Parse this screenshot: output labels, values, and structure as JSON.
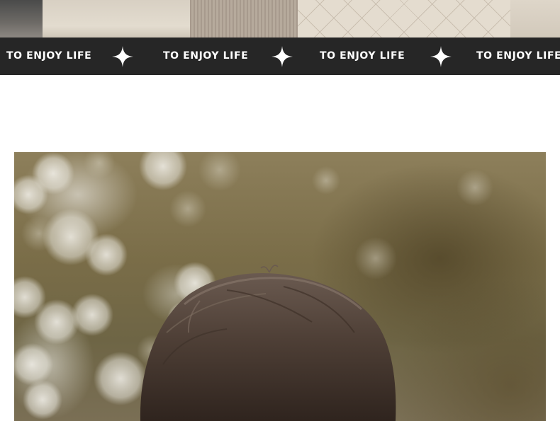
{
  "banner": {
    "phrases": [
      "TO ENJOY LIFE",
      "TO ENJOY LIFE",
      "TO ENJOY LIFE",
      "TO ENJOY LIFE"
    ],
    "separator_icon": "four-point-sparkle-icon",
    "background_color": "#262626",
    "text_color": "#ffffff"
  }
}
